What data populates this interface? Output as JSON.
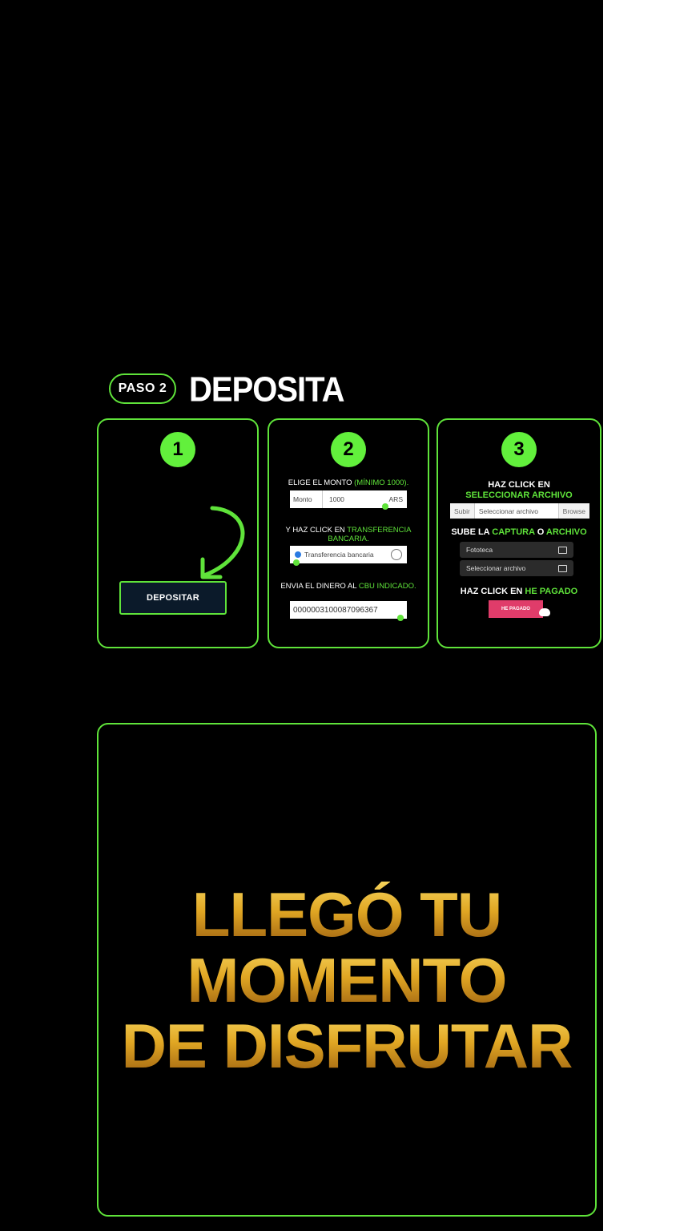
{
  "header": {
    "step_label": "PASO 2",
    "title": "DEPOSITA"
  },
  "cards": [
    {
      "number": "1",
      "button_label": "DEPOSITAR"
    },
    {
      "number": "2",
      "inst1_prefix": "ELIGE EL MONTO ",
      "inst1_highlight": "(MÍNIMO 1000).",
      "amount_label": "Monto",
      "amount_value": "1000",
      "currency": "ARS",
      "inst2_prefix": "Y HAZ CLICK EN ",
      "inst2_highlight": "TRANSFERENCIA BANCARIA.",
      "transfer_option": "Transferencia bancaria",
      "inst3_prefix": "ENVIA EL DINERO AL ",
      "inst3_highlight": "CBU INDICADO.",
      "cbu_value": "0000003100087096367"
    },
    {
      "number": "3",
      "inst1_prefix": "HAZ CLICK EN",
      "inst1_highlight": "SELECCIONAR ARCHIVO",
      "upload_label": "Subir",
      "file_placeholder": "Seleccionar archivo",
      "browse_label": "Browse",
      "inst2_prefix": "SUBE LA ",
      "inst2_highlight1": "CAPTURA",
      "inst2_mid": " O ",
      "inst2_highlight2": "ARCHIVO",
      "option1": "Fototeca",
      "option2": "Seleccionar archivo",
      "inst3_prefix": "HAZ CLICK EN ",
      "inst3_highlight": "HE PAGADO",
      "paid_button": "HE PAGADO"
    }
  ],
  "promo": {
    "line1": "LLEGÓ TU",
    "line2": "MOMENTO",
    "line3": "DE DISFRUTAR"
  },
  "colors": {
    "accent": "#5fe33a",
    "number_bg": "#62f03c",
    "paid_button": "#e03c6a",
    "gold": "#e0a623"
  }
}
